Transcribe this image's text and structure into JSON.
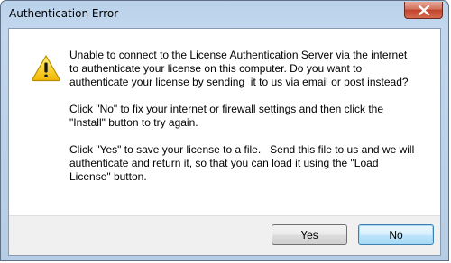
{
  "window": {
    "title": "Authentication Error",
    "close_icon": "close-icon"
  },
  "dialog": {
    "icon": "warning-icon",
    "paragraphs": [
      "Unable to connect to the License Authentication Server via the internet\nto authenticate your license on this computer. Do you want to\nauthenticate your license by sending  it to us via email or post instead?",
      "Click \"No\" to fix your internet or firewall settings and then click the\n\"Install\" button to try again.",
      "Click \"Yes\" to save your license to a file.   Send this file to us and we will\nauthenticate and return it, so that you can load it using the \"Load\nLicense\" button."
    ]
  },
  "buttons": {
    "yes_label": "Yes",
    "no_label": "No"
  },
  "colors": {
    "warning": "#f5c400",
    "close": "#c2432b",
    "default_button_border": "#3c7fb1"
  }
}
